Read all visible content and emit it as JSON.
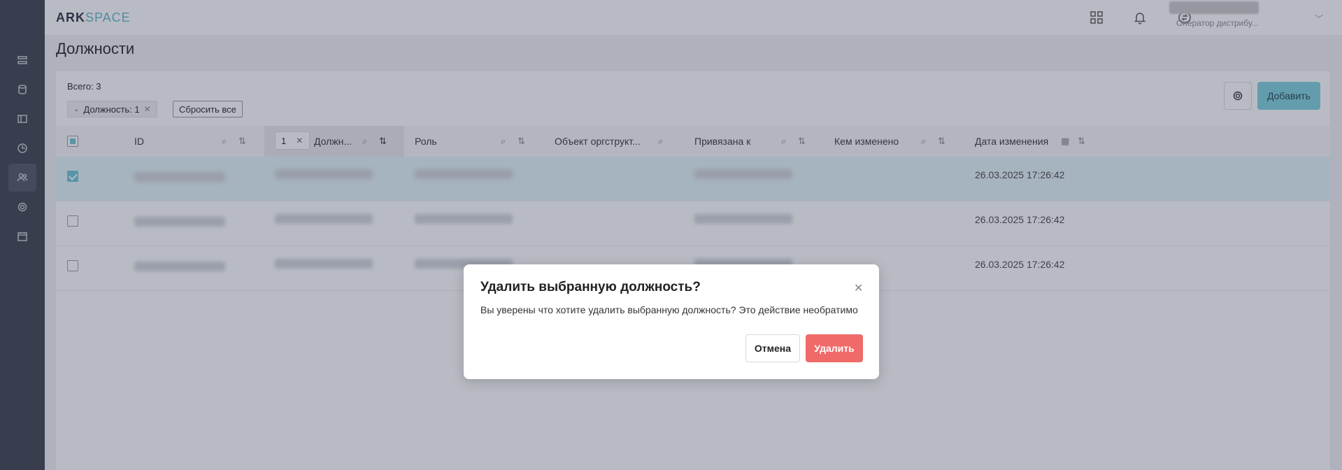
{
  "header": {
    "logo_part1": "ARK",
    "logo_part2": "SPACE",
    "user_role": "Оператор дистрибу..."
  },
  "page": {
    "title": "Должности",
    "total": "Всего: 3",
    "filter_tag": "Должность: 1",
    "reset_label": "Сбросить все",
    "add_label": "Добавить"
  },
  "table": {
    "sort_count": "1",
    "columns": [
      "ID",
      "Должн...",
      "Роль",
      "Объект оргструкт...",
      "Привязана к",
      "Кем изменено",
      "Дата изменения"
    ],
    "rows": [
      {
        "date": "26.03.2025 17:26:42",
        "selected": true
      },
      {
        "date": "26.03.2025 17:26:42",
        "selected": false
      },
      {
        "date": "26.03.2025 17:26:42",
        "selected": false
      }
    ]
  },
  "modal": {
    "title": "Удалить выбранную должность?",
    "text": "Вы уверены что хотите удалить выбранную должность? Это действие необратимо",
    "cancel_label": "Отмена",
    "delete_label": "Удалить"
  },
  "colors": {
    "accent": "#7ccfdc",
    "danger": "#f06a6a",
    "sidebar": "#3a3f4b"
  }
}
